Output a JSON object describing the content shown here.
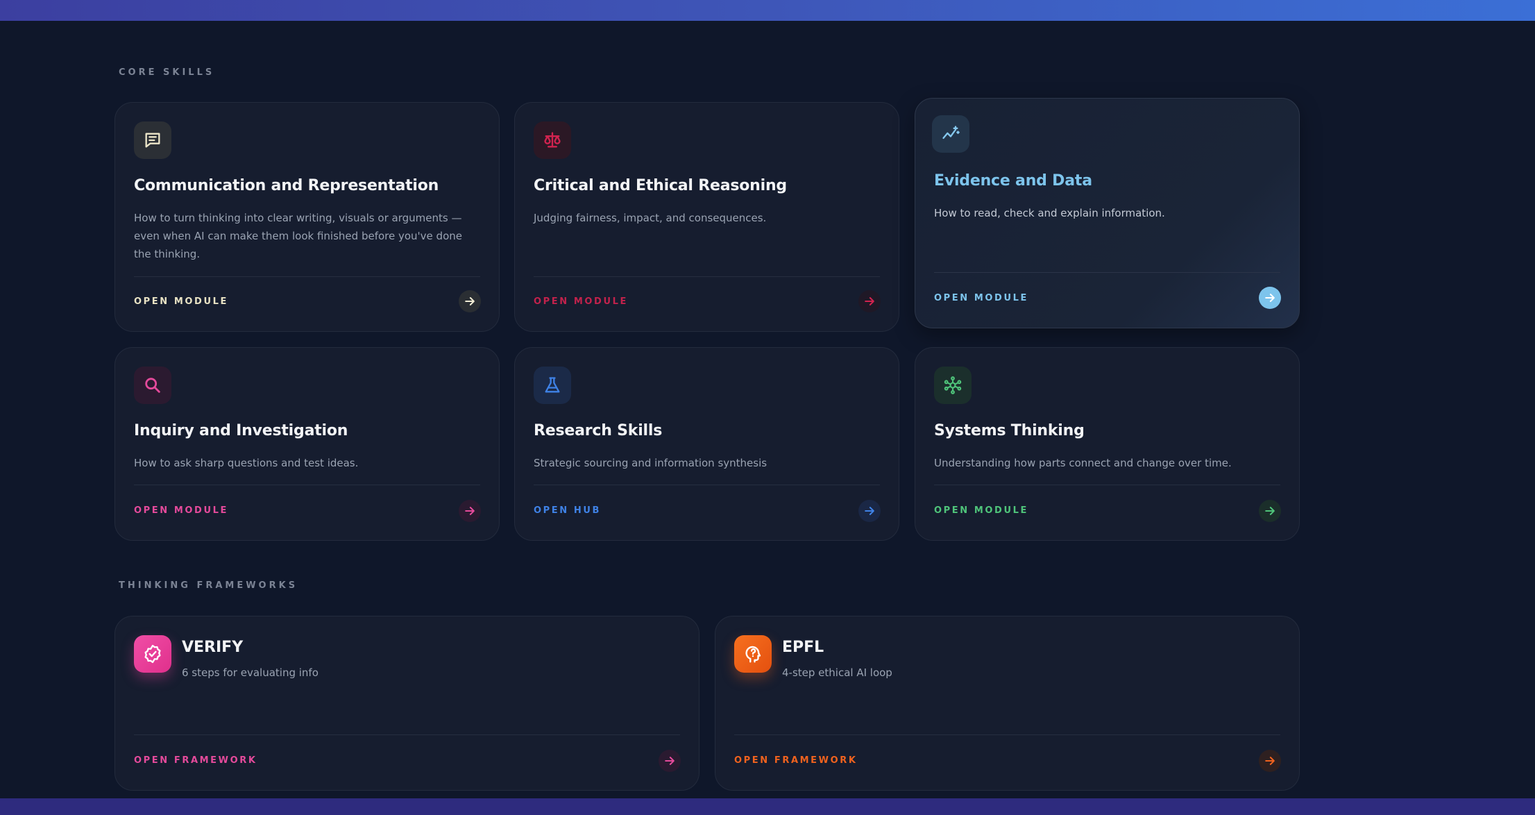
{
  "sections": {
    "core_skills": "CORE SKILLS",
    "thinking_frameworks": "THINKING FRAMEWORKS"
  },
  "core_cards": [
    {
      "title": "Communication and Representation",
      "description": "How to turn thinking into clear writing, visuals or arguments — even when AI can make them look finished before you've done the thinking.",
      "action": "OPEN MODULE",
      "icon": "chat-icon",
      "accent": "#e8e2c4"
    },
    {
      "title": "Critical and Ethical Reasoning",
      "description": "Judging fairness, impact, and consequences.",
      "action": "OPEN MODULE",
      "icon": "scale-icon",
      "accent": "#d1234f"
    },
    {
      "title": "Evidence and Data",
      "description": "How to read, check and explain information.",
      "action": "OPEN MODULE",
      "icon": "trend-sparkle-icon",
      "accent": "#7dc4ec"
    },
    {
      "title": "Inquiry and Investigation",
      "description": "How to ask sharp questions and test ideas.",
      "action": "OPEN MODULE",
      "icon": "search-icon",
      "accent": "#e44a9b"
    },
    {
      "title": "Research Skills",
      "description": "Strategic sourcing and information synthesis",
      "action": "OPEN HUB",
      "icon": "flask-icon",
      "accent": "#3f82e6"
    },
    {
      "title": "Systems Thinking",
      "description": "Understanding how parts connect and change over time.",
      "action": "OPEN MODULE",
      "icon": "network-icon",
      "accent": "#4fc47a"
    }
  ],
  "frameworks": [
    {
      "title": "VERIFY",
      "subtitle": "6 steps for evaluating info",
      "action": "OPEN FRAMEWORK",
      "icon": "verified-badge-icon",
      "accent": "#e8449a"
    },
    {
      "title": "EPFL",
      "subtitle": "4-step ethical AI loop",
      "action": "OPEN FRAMEWORK",
      "icon": "head-question-icon",
      "accent": "#f0621e"
    }
  ]
}
